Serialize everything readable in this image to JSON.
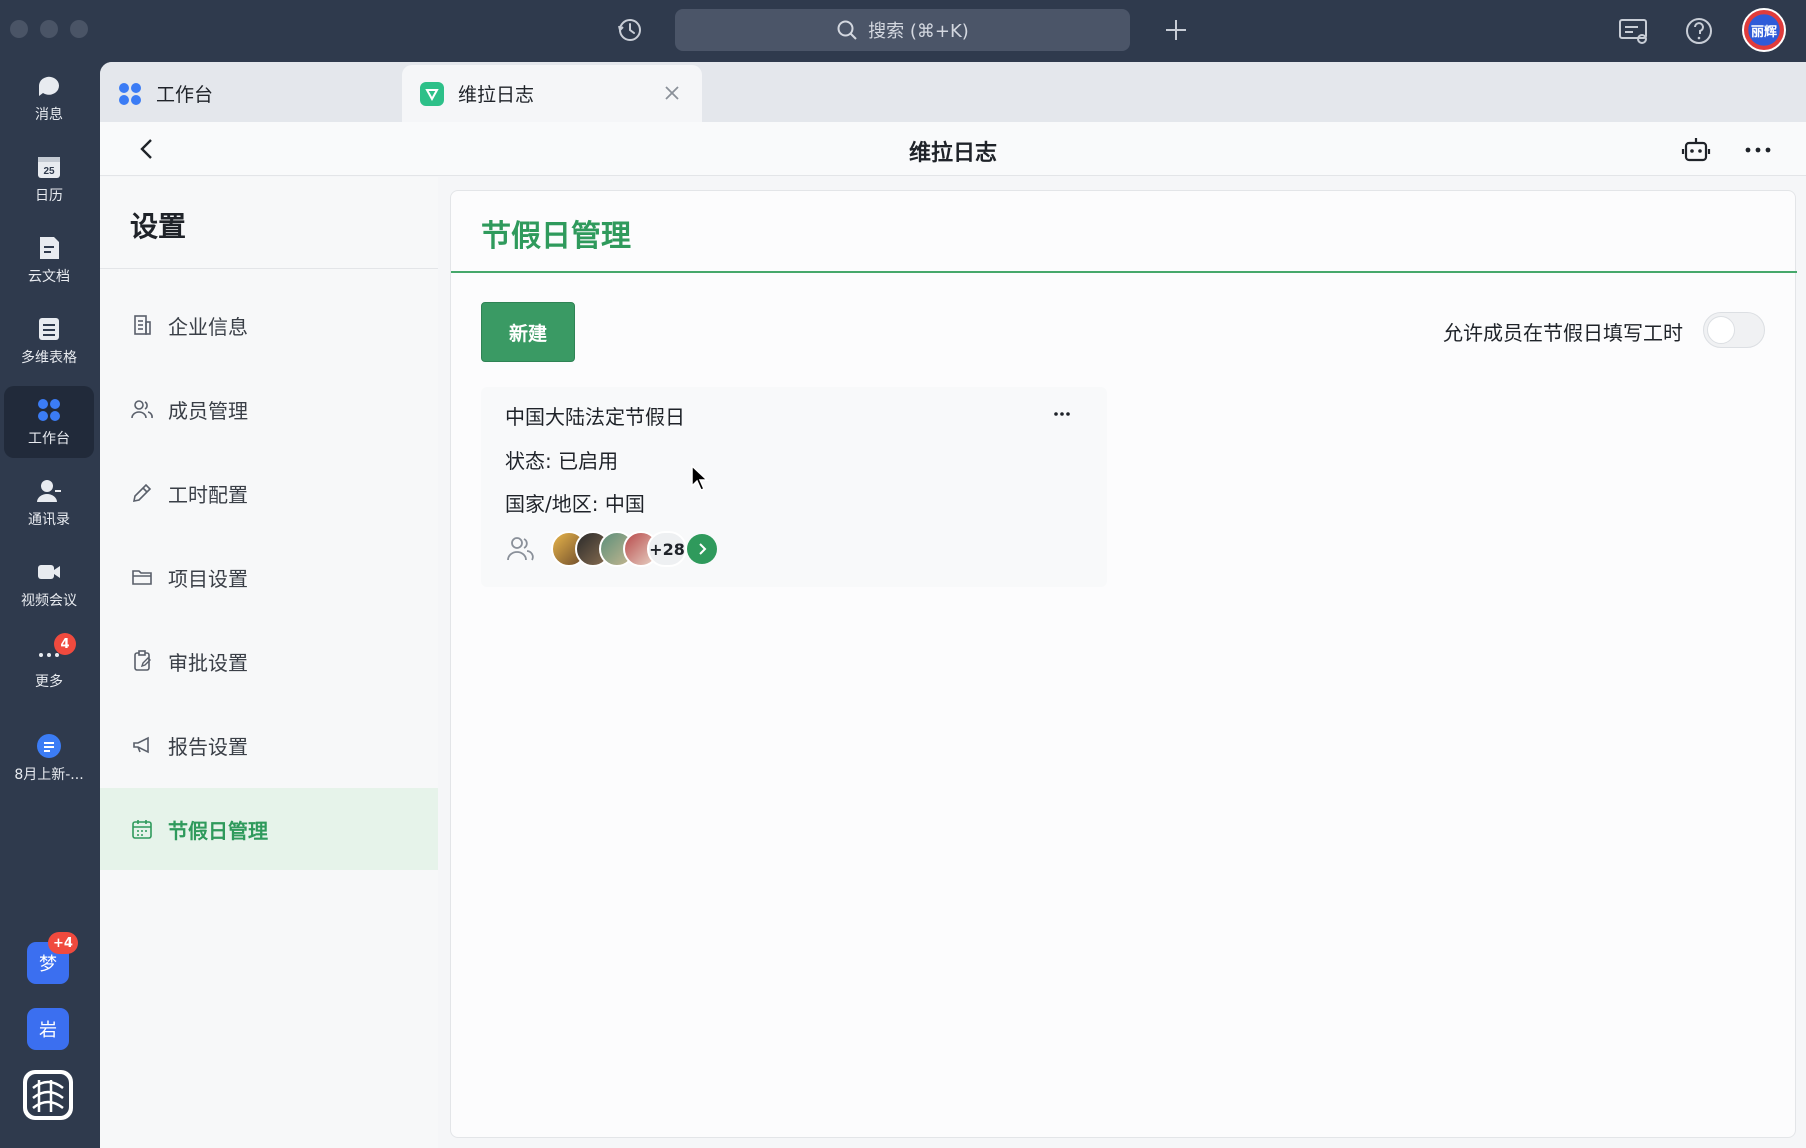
{
  "topbar": {
    "search_placeholder": "搜索 (⌘+K)",
    "user_avatar_text": "丽辉"
  },
  "rail": {
    "items": [
      {
        "label": "消息",
        "icon": "message-icon"
      },
      {
        "label": "日历",
        "icon": "calendar-icon",
        "day": "25"
      },
      {
        "label": "云文档",
        "icon": "cloud-doc-icon"
      },
      {
        "label": "多维表格",
        "icon": "table-icon"
      },
      {
        "label": "工作台",
        "icon": "workspace-icon"
      },
      {
        "label": "通讯录",
        "icon": "contacts-icon"
      },
      {
        "label": "视频会议",
        "icon": "video-icon"
      },
      {
        "label": "更多",
        "icon": "more-icon",
        "badge": "4"
      },
      {
        "label": "8月上新-...",
        "icon": "doc-icon"
      }
    ],
    "apps": [
      {
        "label": "梦",
        "badge": "+4",
        "color": "#3b6ff0"
      },
      {
        "label": "岩",
        "color": "#3b6ff0"
      }
    ]
  },
  "tabs": [
    {
      "label": "工作台"
    },
    {
      "label": "维拉日志"
    }
  ],
  "appbar": {
    "title": "维拉日志"
  },
  "settings": {
    "title": "设置",
    "menu": [
      {
        "label": "企业信息",
        "icon": "building-icon"
      },
      {
        "label": "成员管理",
        "icon": "users-icon"
      },
      {
        "label": "工时配置",
        "icon": "pencil-icon"
      },
      {
        "label": "项目设置",
        "icon": "folder-icon"
      },
      {
        "label": "审批设置",
        "icon": "clipboard-icon"
      },
      {
        "label": "报告设置",
        "icon": "megaphone-icon"
      },
      {
        "label": "节假日管理",
        "icon": "calendar-grid-icon",
        "active": true
      }
    ]
  },
  "panel": {
    "title": "节假日管理",
    "new_button": "新建",
    "toggle_label": "允许成员在节假日填写工时",
    "toggle_on": false
  },
  "card": {
    "title": "中国大陆法定节假日",
    "status": "状态: 已启用",
    "region": "国家/地区: 中国",
    "more_count": "+28"
  },
  "colors": {
    "accent": "#2f9a5c",
    "rail_bg": "#2f3a4d"
  }
}
